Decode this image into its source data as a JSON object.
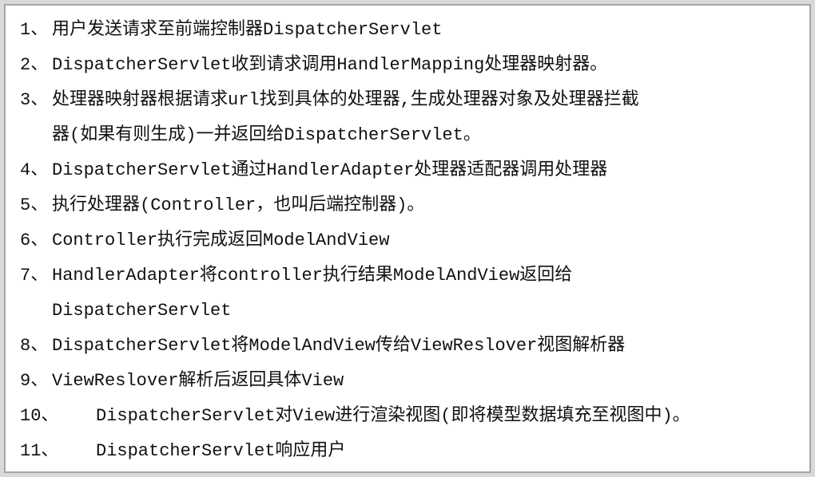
{
  "items": [
    {
      "num": "1、",
      "lines": [
        "用户发送请求至前端控制器DispatcherServlet"
      ]
    },
    {
      "num": "2、",
      "lines": [
        "DispatcherServlet收到请求调用HandlerMapping处理器映射器。"
      ]
    },
    {
      "num": "3、",
      "lines": [
        "处理器映射器根据请求url找到具体的处理器,生成处理器对象及处理器拦截",
        "器(如果有则生成)一并返回给DispatcherServlet。"
      ]
    },
    {
      "num": "4、",
      "lines": [
        "DispatcherServlet通过HandlerAdapter处理器适配器调用处理器"
      ]
    },
    {
      "num": "5、",
      "lines": [
        "执行处理器(Controller，也叫后端控制器)。"
      ]
    },
    {
      "num": "6、",
      "lines": [
        "Controller执行完成返回ModelAndView"
      ]
    },
    {
      "num": "7、",
      "lines": [
        "HandlerAdapter将controller执行结果ModelAndView返回给",
        "DispatcherServlet"
      ]
    },
    {
      "num": "8、",
      "lines": [
        "DispatcherServlet将ModelAndView传给ViewReslover视图解析器"
      ]
    },
    {
      "num": "9、",
      "lines": [
        "ViewReslover解析后返回具体View"
      ]
    },
    {
      "num": "10、",
      "lines": [
        "DispatcherServlet对View进行渲染视图(即将模型数据填充至视图中)。"
      ]
    },
    {
      "num": "11、",
      "lines": [
        "DispatcherServlet响应用户"
      ]
    }
  ]
}
